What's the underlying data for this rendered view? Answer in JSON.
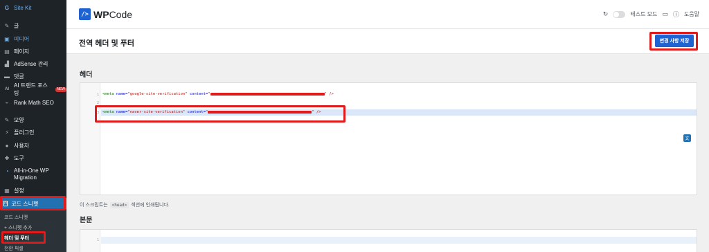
{
  "sidebar": {
    "items": [
      {
        "label": "Site Kit",
        "icon": "G"
      },
      {
        "label": "글",
        "icon": "📌"
      },
      {
        "label": "미디어",
        "icon": "🖼"
      },
      {
        "label": "페이지",
        "icon": "▤"
      },
      {
        "label": "AdSense 관리",
        "icon": "▟"
      },
      {
        "label": "댓글",
        "icon": "▬"
      },
      {
        "label": "AI 트렌드 포스팅",
        "icon": "AI",
        "badge": "NEW"
      },
      {
        "label": "Rank Math SEO",
        "icon": "⌁"
      },
      {
        "label": "모양",
        "icon": "✎"
      },
      {
        "label": "플러그인",
        "icon": "⚡"
      },
      {
        "label": "사용자",
        "icon": "👤"
      },
      {
        "label": "도구",
        "icon": "🔧"
      },
      {
        "label": "All-in-One WP Migration",
        "icon": "◔"
      },
      {
        "label": "설정",
        "icon": "▦"
      }
    ],
    "active": {
      "label": "코드 스니펫",
      "icon": "/>"
    },
    "submenu": [
      "코드 스니펫",
      "+ 스니펫 추가",
      "헤더 및 푸터",
      "전환 픽셀"
    ]
  },
  "topbar": {
    "logo_text_bold": "WP",
    "logo_text": "Code",
    "test_mode_label": "테스트 모드",
    "help_label": "도움말"
  },
  "page": {
    "title": "전역 헤더 및 푸터",
    "save_label": "변경 사항 저장"
  },
  "header_section": {
    "label": "헤더",
    "line_numbers": [
      "1",
      "2",
      "3"
    ],
    "line1": {
      "tag_open": "<meta ",
      "attr1": "name=",
      "val1": "\"google-site-verification\"",
      "attr2": " content=",
      "quote": "\"",
      "close": "\" />"
    },
    "line3": {
      "tag_open": "<meta ",
      "attr1": "name=",
      "val1": "\"naver-site-verification\"",
      "attr2": " content=",
      "quote": "\"",
      "close": "\" />"
    },
    "help_prefix": "이 스크립트는",
    "help_code": "<head>",
    "help_suffix": "섹션에 인쇄됩니다."
  },
  "body_section": {
    "label": "본문",
    "line_numbers": [
      "1"
    ]
  },
  "colors": {
    "accent": "#1f63d3",
    "highlight": "#e01b1b",
    "sidebar_bg": "#1d2327",
    "active_bg": "#2271b1"
  }
}
